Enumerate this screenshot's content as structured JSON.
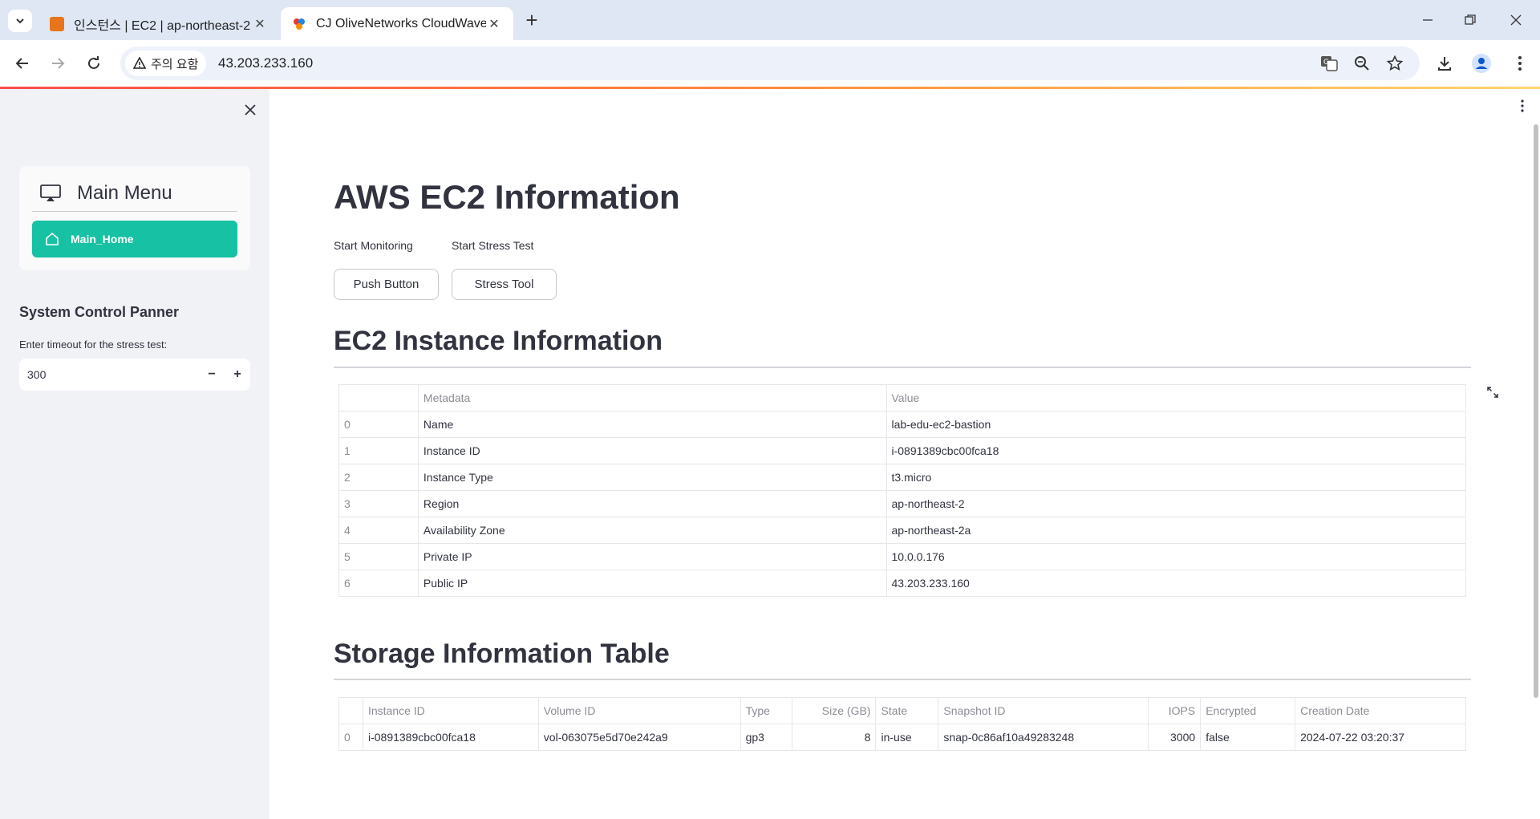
{
  "browser": {
    "tabs": [
      {
        "title": "인스턴스 | EC2 | ap-northeast-2",
        "active": false
      },
      {
        "title": "CJ OliveNetworks CloudWave",
        "active": true
      }
    ],
    "security_chip": "주의 요함",
    "url": "43.203.233.160"
  },
  "sidebar": {
    "menu_title": "Main Menu",
    "menu_item": "Main_Home",
    "panel_title": "System Control Panner",
    "timeout_label": "Enter timeout for the stress test:",
    "timeout_value": "300",
    "accent": "#17c1a3"
  },
  "main": {
    "title": "AWS EC2 Information",
    "monitor_label": "Start Monitoring",
    "monitor_button": "Push Button",
    "stress_label": "Start Stress Test",
    "stress_button": "Stress Tool",
    "instance_heading": "EC2 Instance Information",
    "instance_table": {
      "columns": [
        "",
        "Metadata",
        "Value"
      ],
      "rows": [
        [
          "0",
          "Name",
          "lab-edu-ec2-bastion"
        ],
        [
          "1",
          "Instance ID",
          "i-0891389cbc00fca18"
        ],
        [
          "2",
          "Instance Type",
          "t3.micro"
        ],
        [
          "3",
          "Region",
          "ap-northeast-2"
        ],
        [
          "4",
          "Availability Zone",
          "ap-northeast-2a"
        ],
        [
          "5",
          "Private IP",
          "10.0.0.176"
        ],
        [
          "6",
          "Public IP",
          "43.203.233.160"
        ]
      ]
    },
    "storage_heading": "Storage Information Table",
    "storage_table": {
      "columns": [
        "",
        "Instance ID",
        "Volume ID",
        "Type",
        "Size (GB)",
        "State",
        "Snapshot ID",
        "IOPS",
        "Encrypted",
        "Creation Date"
      ],
      "rows": [
        [
          "0",
          "i-0891389cbc00fca18",
          "vol-063075e5d70e242a9",
          "gp3",
          "8",
          "in-use",
          "snap-0c86af10a49283248",
          "3000",
          "false",
          "2024-07-22 03:20:37"
        ]
      ]
    }
  }
}
